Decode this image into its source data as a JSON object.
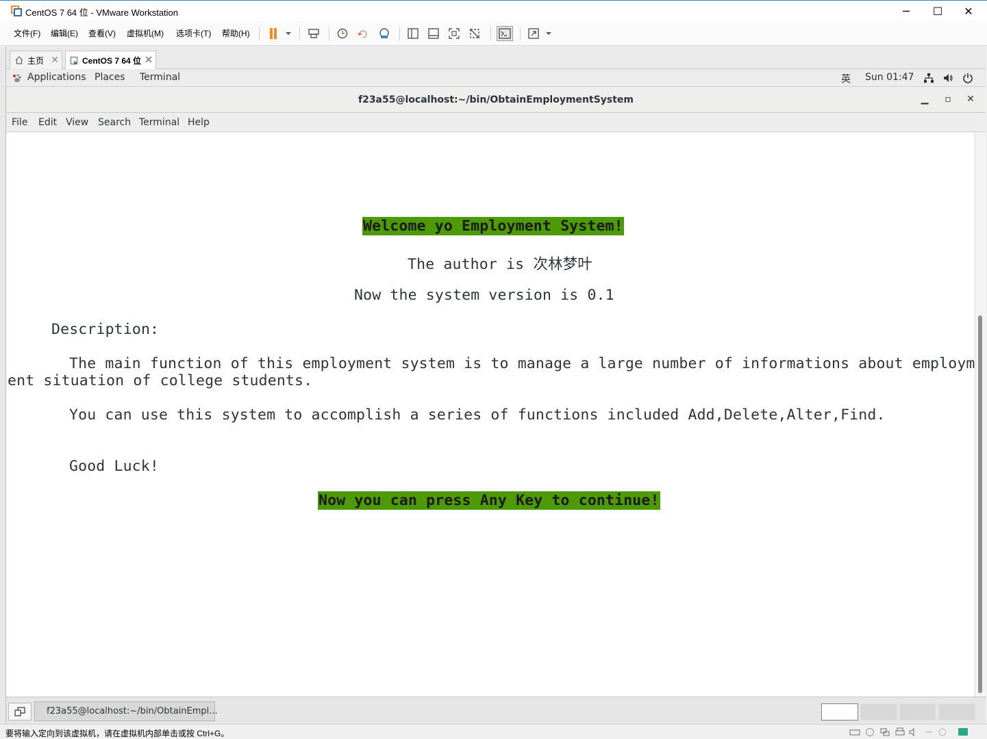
{
  "window": {
    "title": "CentOS 7 64 位 - VMware Workstation",
    "minimize": "─",
    "maximize": "☐",
    "close": "✕"
  },
  "vm_menu": [
    "文件(F)",
    "编辑(E)",
    "查看(V)",
    "虚拟机(M)",
    "选项卡(T)",
    "帮助(H)"
  ],
  "tabs": [
    {
      "label": "主页",
      "close": "✕"
    },
    {
      "label": "CentOS 7 64 位",
      "close": "✕"
    }
  ],
  "gnome_panel": {
    "applications": "Applications",
    "places": "Places",
    "terminal": "Terminal",
    "input_method": "英",
    "clock": "Sun 01:47"
  },
  "terminal": {
    "title": "f23a55@localhost:~/bin/ObtainEmploymentSystem",
    "minimize": "▁",
    "maximize": "▫",
    "close": "✕",
    "menu": [
      "File",
      "Edit",
      "View",
      "Search",
      "Terminal",
      "Help"
    ],
    "lines": {
      "welcome": "Welcome yo Employment System!",
      "author": "The author is 次林梦叶",
      "version": "Now the system version is 0.1",
      "description_header": "Description:",
      "desc1a": "The main function of this employment system is to manage a large number of informations about employm",
      "desc1b": "ent situation of college students.",
      "desc2": "You can use this system to accomplish a series of functions included Add,Delete,Alter,Find.",
      "good_luck": "Good Luck!",
      "continue": "Now you can press Any Key to continue!"
    }
  },
  "taskbar": {
    "task_label": "f23a55@localhost:~/bin/ObtainEmpl..."
  },
  "statusbar": {
    "text": "要将输入定向到该虚拟机，请在虚拟机内部单击或按 Ctrl+G。"
  },
  "colors": {
    "highlight": "#4e9a06",
    "terminal_bg": "#ffffff",
    "terminal_fg": "#2e3436",
    "pause_icon": "#f08a24"
  }
}
